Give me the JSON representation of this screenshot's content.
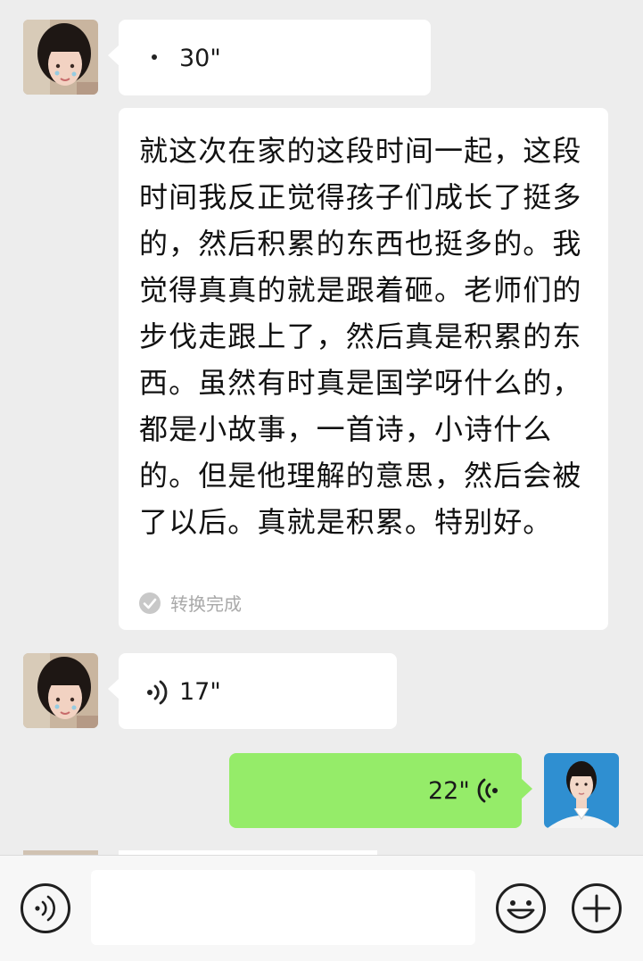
{
  "messages": [
    {
      "type": "voice",
      "side": "left",
      "duration": "30\""
    },
    {
      "type": "transcription",
      "side": "left",
      "text": "就这次在家的这段时间一起，这段时间我反正觉得孩子们成长了挺多的，然后积累的东西也挺多的。我觉得真真的就是跟着砸。老师们的步伐走跟上了，然后真是积累的东西。虽然有时真是国学呀什么的，都是小故事，一首诗，小诗什么的。但是他理解的意思，然后会被了以后。真就是积累。特别好。",
      "status": "转换完成"
    },
    {
      "type": "voice",
      "side": "left",
      "duration": "17\""
    },
    {
      "type": "voice",
      "side": "right",
      "duration": "22\""
    }
  ],
  "input_bar": {
    "placeholder": ""
  },
  "colors": {
    "background": "#ededed",
    "sent_bubble": "#95ec69",
    "received_bubble": "#ffffff"
  },
  "icons": [
    "voice-mode-icon",
    "emoji-icon",
    "plus-icon",
    "voice-wave-icon",
    "check-circle-icon"
  ]
}
